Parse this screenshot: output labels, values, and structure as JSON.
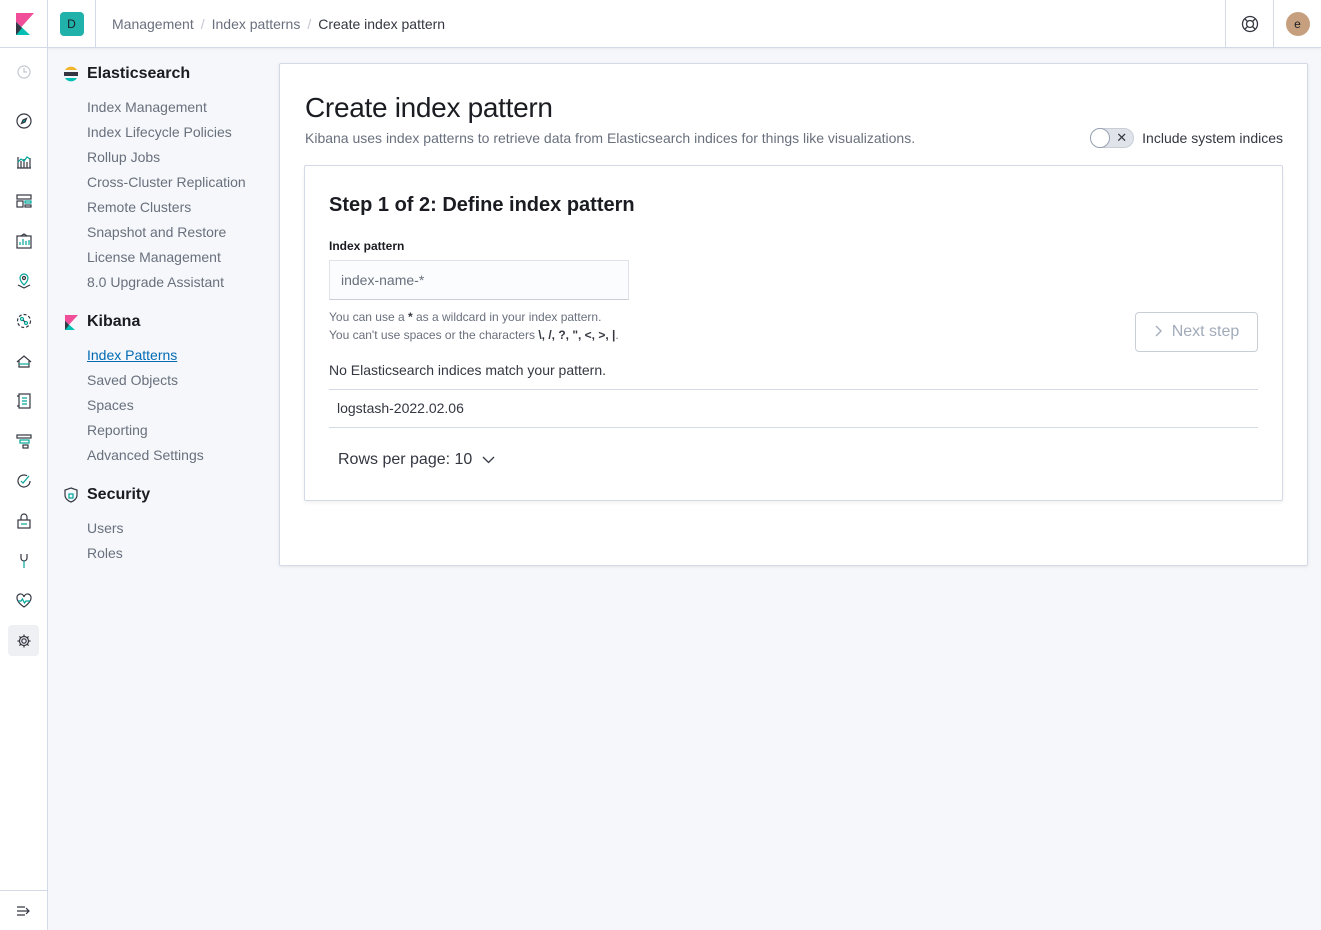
{
  "header": {
    "space_initial": "D",
    "breadcrumbs": [
      "Management",
      "Index patterns",
      "Create index pattern"
    ],
    "breadcrumb_separator": "/",
    "user_initial": "e"
  },
  "rail": {
    "icons": [
      "clock-icon",
      "compass-icon",
      "visualize-icon",
      "dashboard-icon",
      "canvas-icon",
      "maps-icon",
      "ml-icon",
      "infrastructure-icon",
      "logs-icon",
      "apm-icon",
      "uptime-icon",
      "siem-icon",
      "devtools-icon",
      "monitoring-icon",
      "gear-icon"
    ],
    "active": "gear-icon",
    "collapse_icon": "dock-icon"
  },
  "sidenav": {
    "sections": [
      {
        "title": "Elasticsearch",
        "icon": "elasticsearch-logo",
        "items": [
          "Index Management",
          "Index Lifecycle Policies",
          "Rollup Jobs",
          "Cross-Cluster Replication",
          "Remote Clusters",
          "Snapshot and Restore",
          "License Management",
          "8.0 Upgrade Assistant"
        ]
      },
      {
        "title": "Kibana",
        "icon": "kibana-logo",
        "items": [
          "Index Patterns",
          "Saved Objects",
          "Spaces",
          "Reporting",
          "Advanced Settings"
        ]
      },
      {
        "title": "Security",
        "icon": "shield-icon",
        "items": [
          "Users",
          "Roles"
        ]
      }
    ],
    "active_item": "Index Patterns"
  },
  "main": {
    "title": "Create index pattern",
    "description": "Kibana uses index patterns to retrieve data from Elasticsearch indices for things like visualizations.",
    "toggle_label": "Include system indices",
    "toggle_on": false,
    "step_title": "Step 1 of 2: Define index pattern",
    "field_label": "Index pattern",
    "field_placeholder": "index-name-*",
    "field_value": "",
    "help_line1_pre": "You can use a ",
    "help_line1_strong": "*",
    "help_line1_post": " as a wildcard in your index pattern.",
    "help_line2_pre": "You can't use spaces or the characters ",
    "help_line2_strong": "\\, /, ?, \", <, >, |",
    "help_line2_post": ".",
    "next_button": "Next step",
    "next_enabled": false,
    "no_match": "No Elasticsearch indices match your pattern.",
    "indices": [
      "logstash-2022.02.06"
    ],
    "rows_per_page": "Rows per page: 10"
  },
  "colors": {
    "link_active": "#006bb4",
    "space_badge": "#20b2aa",
    "avatar": "#c6a07e"
  }
}
